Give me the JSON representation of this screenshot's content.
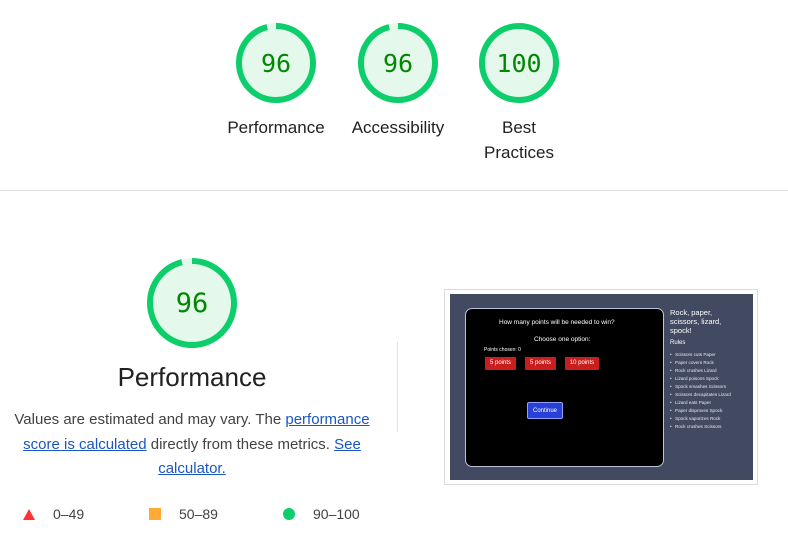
{
  "colors": {
    "pass": "#0cce6b",
    "pass_fill": "#e5f8ec",
    "score_text": "#008800",
    "fail": "#ff3333",
    "average": "#ffaa33",
    "link": "#1a56c4"
  },
  "categories": [
    {
      "score": "96",
      "value": 96,
      "label": "Performance"
    },
    {
      "score": "96",
      "value": 96,
      "label": "Accessibility"
    },
    {
      "score": "100",
      "value": 100,
      "label": "Best Practices"
    }
  ],
  "performance": {
    "score": "96",
    "value": 96,
    "title": "Performance",
    "desc_prefix": "Values are estimated and may vary. The ",
    "link_score": "performance score is calculated",
    "desc_middle": " directly from these metrics. ",
    "link_calc": "See calculator."
  },
  "legend": [
    {
      "range": "0–49",
      "icon": "triangle-icon"
    },
    {
      "range": "50–89",
      "icon": "square-icon"
    },
    {
      "range": "90–100",
      "icon": "circle-icon"
    }
  ],
  "screenshot": {
    "question": "How many points will be needed to win?",
    "choose": "Choose one option:",
    "points_chosen": "Points chosen: 0",
    "options": [
      "5 points",
      "5 points",
      "10 points"
    ],
    "continue": "Continue",
    "side_title": "Rock, paper, scissors, lizard, spock!",
    "rules_heading": "Rules",
    "rules": [
      "Scissors cuts Paper",
      "Paper covers Rock",
      "Rock crushes Lizard",
      "Lizard poisons Spock",
      "Spock smashes Scissors",
      "Scissors decapitates Lizard",
      "Lizard eats Paper",
      "Paper disproves Spock",
      "Spock vaporizes Rock",
      "Rock crushes Scissors"
    ]
  }
}
